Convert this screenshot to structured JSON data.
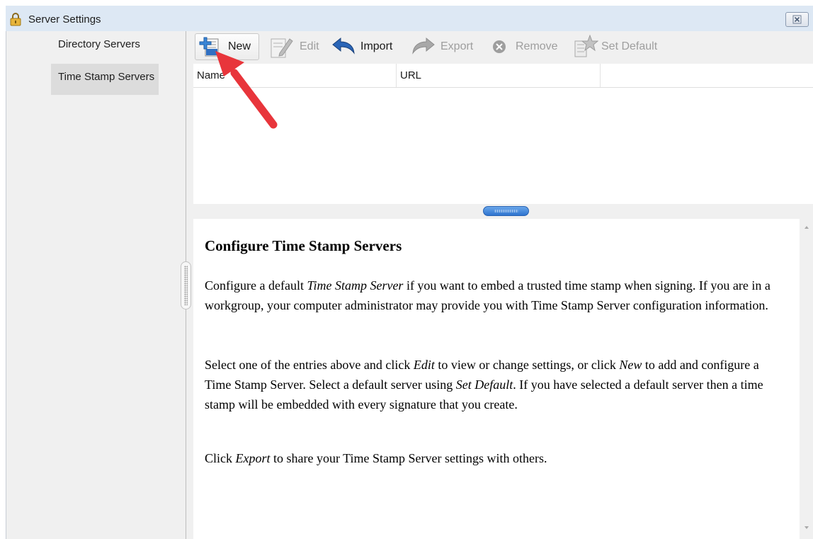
{
  "window": {
    "title": "Server Settings",
    "close_icon": "close-icon"
  },
  "sidebar": {
    "items": [
      {
        "label": "Directory Servers",
        "selected": false
      },
      {
        "label": "Time Stamp Servers",
        "selected": true
      }
    ]
  },
  "toolbar": {
    "new_label": "New",
    "edit_label": "Edit",
    "import_label": "Import",
    "export_label": "Export",
    "remove_label": "Remove",
    "set_default_label": "Set Default"
  },
  "table": {
    "columns": [
      "Name",
      "URL"
    ],
    "rows": []
  },
  "help": {
    "heading": "Configure Time Stamp Servers",
    "p1": {
      "a": "Configure a default ",
      "em1": "Time Stamp Server",
      "b": " if you want to embed a trusted time stamp when signing. If you are in a workgroup, your computer administrator may provide you with Time Stamp Server configuration information."
    },
    "p2": {
      "a": "Select one of the entries above and click ",
      "em1": "Edit",
      "b": " to view or change settings, or click ",
      "em2": "New",
      "c": " to add and configure a Time Stamp Server. Select a default server using ",
      "em3": "Set Default",
      "d": ". If you have selected a default server then a time stamp will be embedded with every signature that you create."
    },
    "p3": {
      "a": "Click ",
      "em1": "Export",
      "b": " to share your Time Stamp Server settings with others."
    }
  },
  "annotation": {
    "arrow_color": "#e8353b"
  }
}
